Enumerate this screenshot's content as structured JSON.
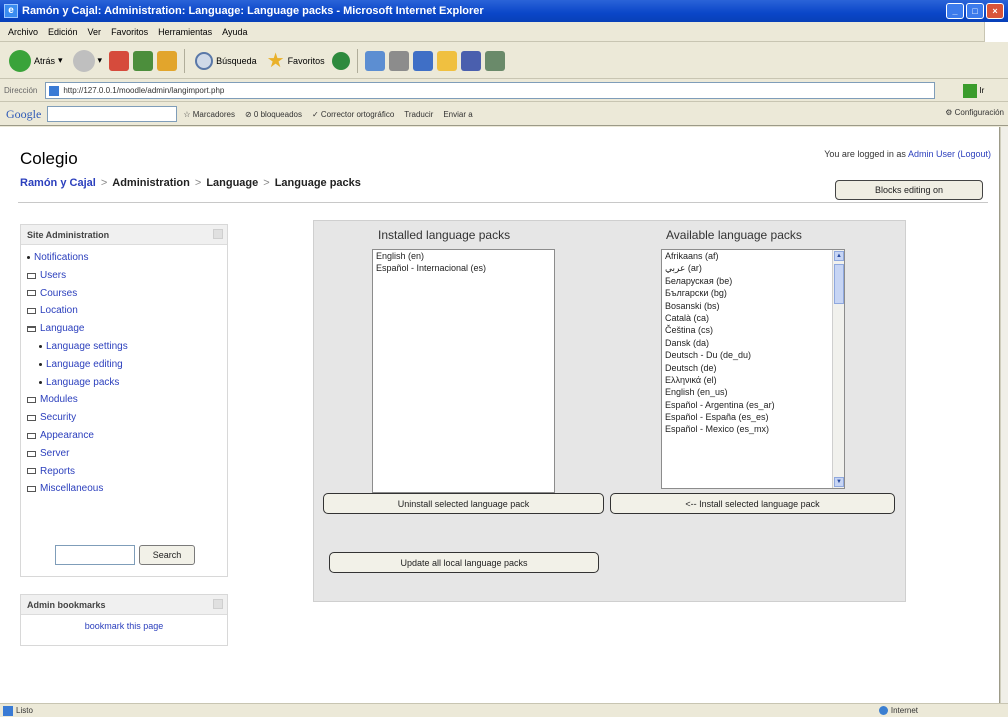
{
  "window": {
    "title": "Ramón y Cajal: Administration: Language: Language packs - Microsoft Internet Explorer"
  },
  "menu": [
    "Archivo",
    "Edición",
    "Ver",
    "Favoritos",
    "Herramientas",
    "Ayuda"
  ],
  "toolbar": {
    "back_label": "Atrás",
    "search_label": "Búsqueda",
    "favorites_label": "Favoritos"
  },
  "address": {
    "label": "Dirección",
    "url": "http://127.0.0.1/moodle/admin/langimport.php",
    "go_label": "Ir"
  },
  "googlebar": {
    "logo": "Google",
    "bookmarks": "Marcadores",
    "blocked": "0 bloqueados",
    "spellcheck": "Corrector ortográfico",
    "translate": "Traducir",
    "send": "Enviar a",
    "settings": "Configuración"
  },
  "page": {
    "site_name": "Colegio",
    "logged_in_prefix": "You are logged in as",
    "user_name": "Admin User",
    "logout": "(Logout)",
    "breadcrumb": [
      "Ramón y Cajal",
      "Administration",
      "Language",
      "Language packs"
    ],
    "blocks_editing_btn": "Blocks editing on"
  },
  "admin_block": {
    "title": "Site Administration",
    "items": [
      {
        "label": "Notifications",
        "type": "bullet",
        "level": 0
      },
      {
        "label": "Users",
        "type": "folder",
        "level": 0
      },
      {
        "label": "Courses",
        "type": "folder",
        "level": 0
      },
      {
        "label": "Location",
        "type": "folder",
        "level": 0
      },
      {
        "label": "Language",
        "type": "folder-open",
        "level": 0
      },
      {
        "label": "Language settings",
        "type": "bullet",
        "level": 1
      },
      {
        "label": "Language editing",
        "type": "bullet",
        "level": 1
      },
      {
        "label": "Language packs",
        "type": "bullet",
        "level": 1
      },
      {
        "label": "Modules",
        "type": "folder",
        "level": 0
      },
      {
        "label": "Security",
        "type": "folder",
        "level": 0
      },
      {
        "label": "Appearance",
        "type": "folder",
        "level": 0
      },
      {
        "label": "Server",
        "type": "folder",
        "level": 0
      },
      {
        "label": "Reports",
        "type": "folder",
        "level": 0
      },
      {
        "label": "Miscellaneous",
        "type": "folder",
        "level": 0
      }
    ],
    "search_button": "Search"
  },
  "bookmarks_block": {
    "title": "Admin bookmarks",
    "link": "bookmark this page"
  },
  "installed": {
    "title": "Installed language packs",
    "items": [
      "English (en)",
      "Español - Internacional (es)"
    ],
    "uninstall_btn": "Uninstall selected language pack"
  },
  "available": {
    "title": "Available language packs",
    "items": [
      "Afrikaans (af)",
      "عربي (ar)",
      "Беларуская (be)",
      "Български (bg)",
      "Bosanski (bs)",
      "Català (ca)",
      "Čeština (cs)",
      "Dansk (da)",
      "Deutsch - Du (de_du)",
      "Deutsch (de)",
      "Ελληνικά (el)",
      "English (en_us)",
      "Español - Argentina (es_ar)",
      "Español - España (es_es)",
      "Español - Mexico (es_mx)"
    ],
    "install_btn": "<-- Install selected language pack"
  },
  "update_btn": "Update all local language packs",
  "status": {
    "text": "Listo",
    "zone": "Internet"
  }
}
